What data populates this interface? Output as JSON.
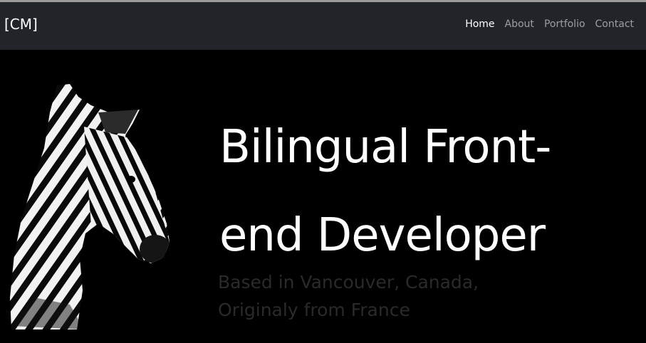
{
  "navbar": {
    "brand": "[CM]",
    "links": [
      {
        "label": "Home"
      },
      {
        "label": "About"
      },
      {
        "label": "Portfolio"
      },
      {
        "label": "Contact"
      }
    ]
  },
  "hero": {
    "headline_line1": "Bilingual Front-",
    "headline_line2": "end Developer",
    "subtitle_line1": "Based in Vancouver, Canada,",
    "subtitle_line2": "Originaly from France"
  },
  "icons": {
    "hero_image": "zebra-image"
  },
  "colors": {
    "navbar_bg": "#212529",
    "page_bg": "#000000",
    "nav_link": "rgba(255,255,255,0.55)",
    "nav_active": "#ffffff",
    "subtitle": "#2a2a2a"
  }
}
